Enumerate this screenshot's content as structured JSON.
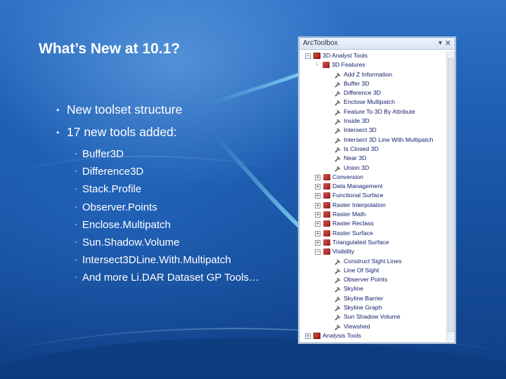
{
  "slide": {
    "title": "What’s New at 10.1?",
    "bullets": [
      "New toolset structure",
      "17 new tools added:"
    ],
    "new_tools": [
      "Buffer3D",
      "Difference3D",
      "Stack.Profile",
      "Observer.Points",
      "Enclose.Multipatch",
      "Sun.Shadow.Volume",
      "Intersect3DLine.With.Multipatch",
      "And more Li.DAR Dataset GP Tools…"
    ]
  },
  "toolbox": {
    "title": "ArcToolbox",
    "pin_icon": "pin-icon",
    "close_icon": "close-icon",
    "root": "3D Analyst Tools",
    "features_set": "3D Features",
    "features_tools": [
      "Add Z Information",
      "Buffer 3D",
      "Difference 3D",
      "Enclose Multipatch",
      "Feature To 3D By Attribute",
      "Inside 3D",
      "Intersect 3D",
      "Intersect 3D Line With Multipatch",
      "Is Closed 3D",
      "Near 3D",
      "Union 3D"
    ],
    "collapsed_sets": [
      "Conversion",
      "Data Management",
      "Functional Surface",
      "Raster Interpolation",
      "Raster Math",
      "Raster Reclass",
      "Raster Surface",
      "Triangulated Surface"
    ],
    "visibility_set": "Visibility",
    "visibility_tools": [
      "Construct Sight Lines",
      "Line Of Sight",
      "Observer Points",
      "Skyline",
      "Skyline Barrier",
      "Skyline Graph",
      "Sun Shadow Volume",
      "Viewshed"
    ],
    "last_item": "Analysis Tools"
  },
  "colors": {
    "background": "#1f5fb3",
    "accent_arrow": "#7fd3f5",
    "tree_text": "#14206e"
  }
}
